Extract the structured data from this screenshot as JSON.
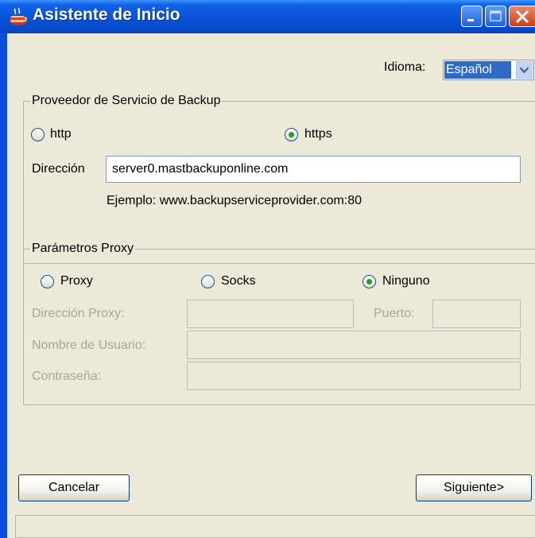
{
  "window": {
    "title": "Asistente de Inicio"
  },
  "language": {
    "label": "Idioma:",
    "selected": "Español"
  },
  "backup_provider": {
    "legend": "Proveedor de Servicio de Backup",
    "protocols": [
      {
        "label": "http",
        "selected": false
      },
      {
        "label": "https",
        "selected": true
      }
    ],
    "address_label": "Dirección",
    "address_value": "server0.mastbackuponline.com",
    "example": "Ejemplo: www.backupserviceprovider.com:80"
  },
  "proxy": {
    "legend": "Parámetros Proxy",
    "types": [
      {
        "label": "Proxy",
        "selected": false
      },
      {
        "label": "Socks",
        "selected": false
      },
      {
        "label": "Ninguno",
        "selected": true
      }
    ],
    "address_label": "Dirección Proxy:",
    "port_label": "Puerto:",
    "username_label": "Nombre de Usuario:",
    "password_label": "Contraseña:",
    "address_value": "",
    "port_value": "",
    "username_value": "",
    "password_value": ""
  },
  "buttons": {
    "cancel": "Cancelar",
    "next": "Siguiente>"
  },
  "colors": {
    "titlebar": "#0a52d8",
    "client": "#ece9d8",
    "selection": "#316ac5",
    "radio_dot": "#21a121"
  }
}
